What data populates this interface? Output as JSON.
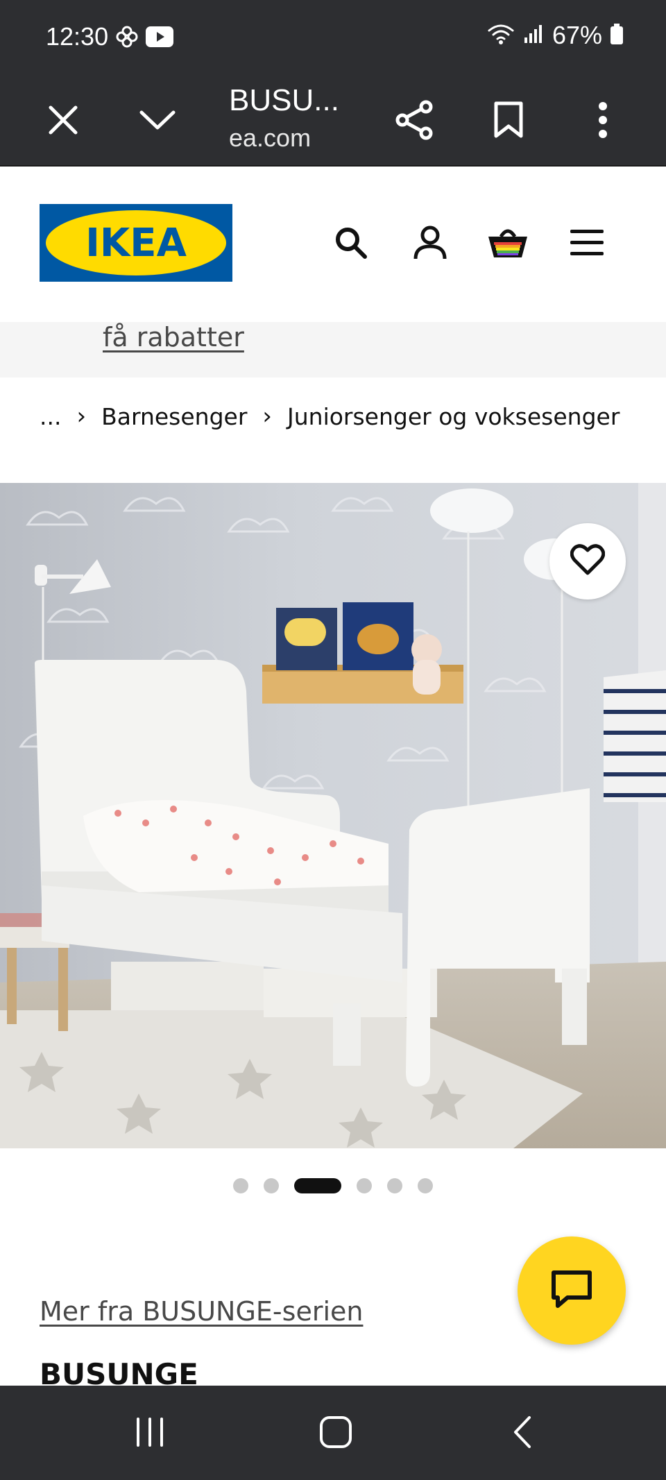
{
  "status_bar": {
    "time": "12:30",
    "battery": "67%",
    "icons": [
      "pinwheel-icon",
      "youtube-icon",
      "wifi-icon",
      "signal-icon",
      "battery-icon"
    ]
  },
  "browser": {
    "title": "BUSU...",
    "domain": "ea.com",
    "icons": [
      "close-icon",
      "chevron-down-icon",
      "share-icon",
      "bookmark-icon",
      "more-vert-icon"
    ]
  },
  "header": {
    "logo_text": "IKEA",
    "icons": [
      "search-icon",
      "account-icon",
      "basket-icon",
      "menu-icon"
    ],
    "colors": {
      "logo_blue": "#0058a3",
      "logo_yellow": "#ffdb00"
    }
  },
  "promo": {
    "link_text": "få rabatter"
  },
  "breadcrumb": {
    "items": [
      "...",
      "Barnesenger",
      "Juniorsenger og voksesenger"
    ]
  },
  "carousel": {
    "total": 6,
    "active_index": 2
  },
  "content": {
    "series_link": "Mer fra BUSUNGE-serien",
    "product_name": "BUSUNGE"
  },
  "chat": {
    "color": "#ffd520",
    "icon": "chat-icon"
  },
  "nav_bar": {
    "icons": [
      "recent-apps-icon",
      "home-icon",
      "back-icon"
    ]
  }
}
